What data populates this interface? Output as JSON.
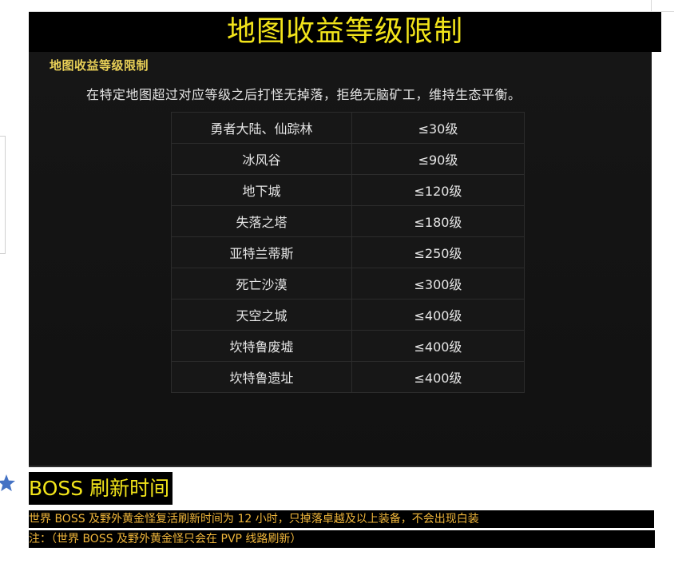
{
  "header": {
    "title": "地图收益等级限制"
  },
  "panel": {
    "title": "地图收益等级限制",
    "description": "在特定地图超过对应等级之后打怪无掉落，拒绝无脑矿工，维持生态平衡。",
    "rows": [
      {
        "map": "勇者大陆、仙踪林",
        "level": "≤30级"
      },
      {
        "map": "冰风谷",
        "level": "≤90级"
      },
      {
        "map": "地下城",
        "level": "≤120级"
      },
      {
        "map": "失落之塔",
        "level": "≤180级"
      },
      {
        "map": "亚特兰蒂斯",
        "level": "≤250级"
      },
      {
        "map": "死亡沙漠",
        "level": "≤300级"
      },
      {
        "map": "天空之城",
        "level": "≤400级"
      },
      {
        "map": "坎特鲁废墟",
        "level": "≤400级"
      },
      {
        "map": "坎特鲁遗址",
        "level": "≤400级"
      }
    ]
  },
  "boss": {
    "icon": "star-icon",
    "heading": "BOSS 刷新时间",
    "line1": "世界 BOSS 及野外黄金怪复活刷新时间为 12 小时，只掉落卓越及以上装备，不会出现白装",
    "line2": "注：（世界 BOSS 及野外黄金怪只会在 PVP 线路刷新）"
  },
  "colors": {
    "heading_yellow": "#f2e41a",
    "note_orange": "#f0b63b",
    "panel_title_gold": "#e8cf57",
    "star_blue": "#4472c4"
  }
}
